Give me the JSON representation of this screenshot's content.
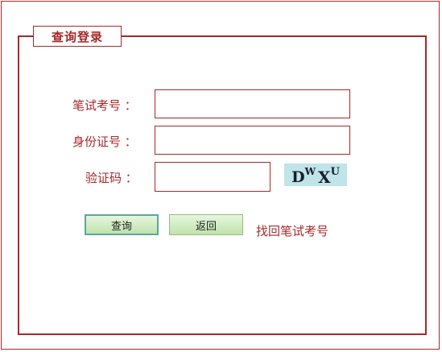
{
  "legend": {
    "title": "查询登录"
  },
  "form": {
    "exam_number": {
      "label": "笔试考号 ：",
      "value": "",
      "placeholder": ""
    },
    "id_number": {
      "label": "身份证号 ：",
      "value": "",
      "placeholder": ""
    },
    "captcha": {
      "label": "验证码 ：",
      "value": "",
      "placeholder": "",
      "image_text": [
        "D",
        "W",
        "X",
        "U"
      ]
    }
  },
  "buttons": {
    "query": "查询",
    "back": "返回"
  },
  "links": {
    "retrieve_exam_number": "找回笔试考号"
  },
  "colors": {
    "accent": "#a52a2a",
    "captcha_bg": "#bfe5e8",
    "button_green": "#bfe3ac"
  }
}
